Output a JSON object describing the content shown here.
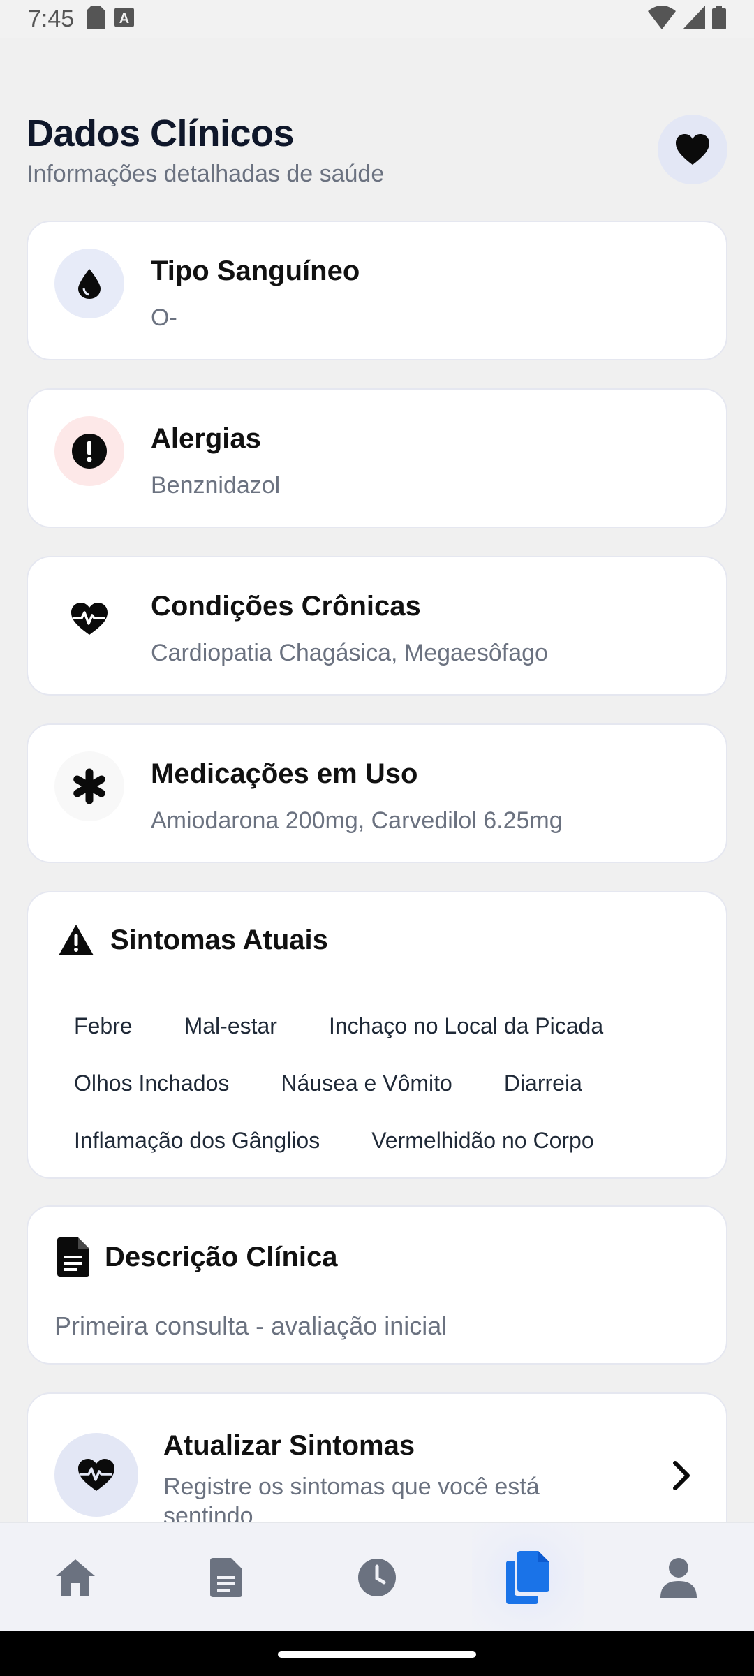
{
  "status_bar": {
    "time": "7:45"
  },
  "header": {
    "title": "Dados Clínicos",
    "subtitle": "Informações detalhadas de saúde"
  },
  "cards": {
    "blood_type": {
      "title": "Tipo Sanguíneo",
      "value": "O-"
    },
    "allergies": {
      "title": "Alergias",
      "value": "Benznidazol"
    },
    "chronic": {
      "title": "Condições Crônicas",
      "value": "Cardiopatia Chagásica, Megaesôfago"
    },
    "medications": {
      "title": "Medicações em Uso",
      "value": "Amiodarona 200mg, Carvedilol 6.25mg"
    }
  },
  "symptoms": {
    "title": "Sintomas Atuais",
    "rows": [
      [
        "Febre",
        "Mal-estar",
        "Inchaço no Local da Picada"
      ],
      [
        "Olhos Inchados",
        "Náusea e Vômito",
        "Diarreia"
      ],
      [
        "Inflamação dos Gânglios",
        "Vermelhidão no Corpo"
      ]
    ]
  },
  "description": {
    "title": "Descrição Clínica",
    "text": "Primeira consulta - avaliação inicial"
  },
  "update": {
    "title": "Atualizar Sintomas",
    "subtitle": "Registre os sintomas que você está sentindo"
  },
  "nav": {
    "items": [
      "home-icon",
      "document-icon",
      "clock-icon",
      "files-icon",
      "person-icon"
    ],
    "active_index": 3
  },
  "colors": {
    "accent": "#1a73e8",
    "icon_dark": "#0b0b0b",
    "nav_inactive": "#6b7280",
    "allergy_bg": "#fde8e8",
    "icon_bg": "#e3e7f5"
  }
}
